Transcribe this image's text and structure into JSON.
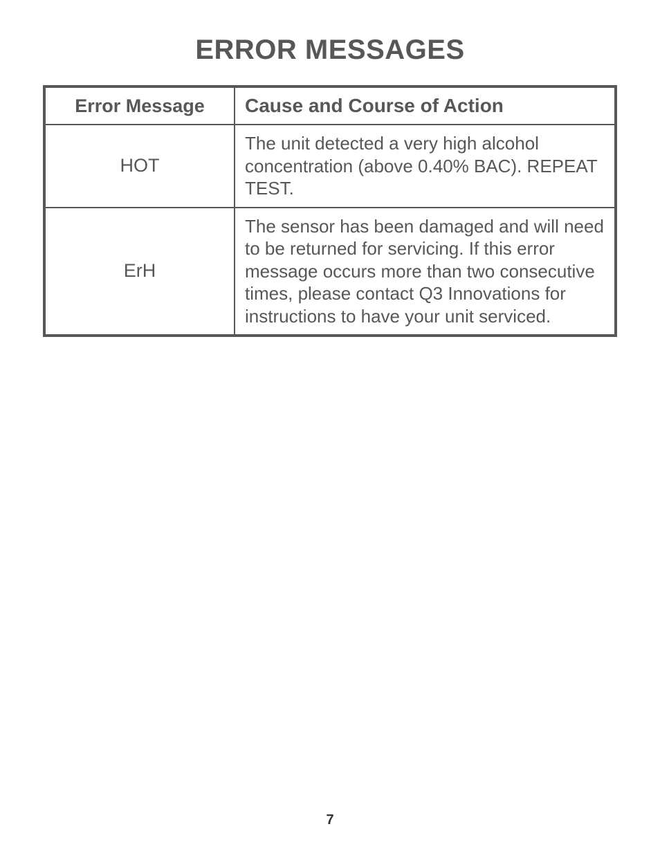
{
  "title": "ERROR MESSAGES",
  "table": {
    "headers": {
      "col1": "Error Message",
      "col2": "Cause and Course of Action"
    },
    "rows": [
      {
        "code": "HOT",
        "desc": "The unit detected a very high alcohol concentration (above 0.40% BAC). REPEAT TEST."
      },
      {
        "code": "ErH",
        "desc": "The sensor has been damaged and will need to be returned for servicing. If this error message occurs more than two consecutive times, please contact Q3 Innovations for instructions to have your unit serviced."
      }
    ]
  },
  "page_number": "7"
}
